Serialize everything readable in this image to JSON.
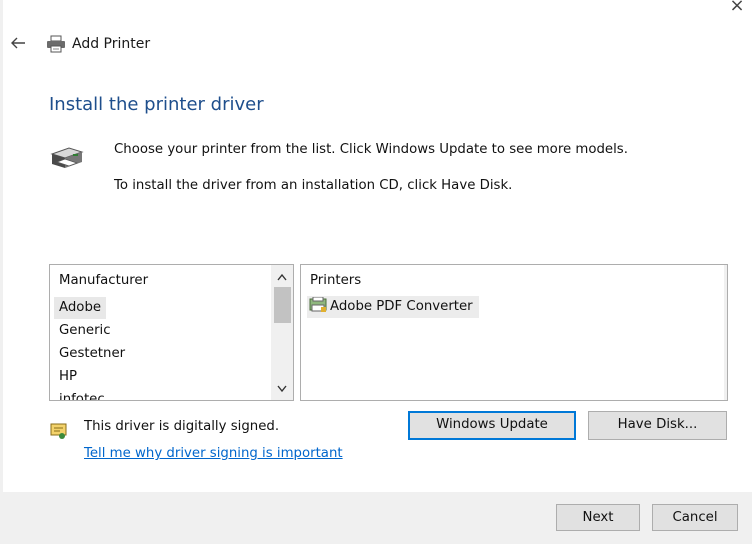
{
  "window": {
    "title": "Add Printer",
    "close_glyph": "×",
    "back_glyph": "←"
  },
  "page": {
    "heading": "Install the printer driver",
    "description_line1": "Choose your printer from the list. Click Windows Update to see more models.",
    "description_line2": "To install the driver from an installation CD, click Have Disk."
  },
  "manufacturer_list": {
    "header": "Manufacturer",
    "items": [
      "Adobe",
      "Generic",
      "Gestetner",
      "HP",
      "infotec"
    ],
    "selected": "Adobe"
  },
  "printers_list": {
    "header": "Printers",
    "items": [
      "Adobe PDF Converter"
    ],
    "selected": "Adobe PDF Converter"
  },
  "signing": {
    "status_text": "This driver is digitally signed.",
    "link_text": "Tell me why driver signing is important"
  },
  "buttons": {
    "windows_update": "Windows Update",
    "have_disk": "Have Disk...",
    "next": "Next",
    "cancel": "Cancel"
  },
  "colors": {
    "heading": "#1e4e8c",
    "link": "#0066cc",
    "default_button_border": "#0078d7",
    "footer_background": "#f0f0f0"
  },
  "icons": [
    "back-arrow-icon",
    "printer-icon",
    "printer-large-icon",
    "scroll-up-icon",
    "scroll-down-icon",
    "printer-driver-icon",
    "signed-certificate-icon"
  ]
}
